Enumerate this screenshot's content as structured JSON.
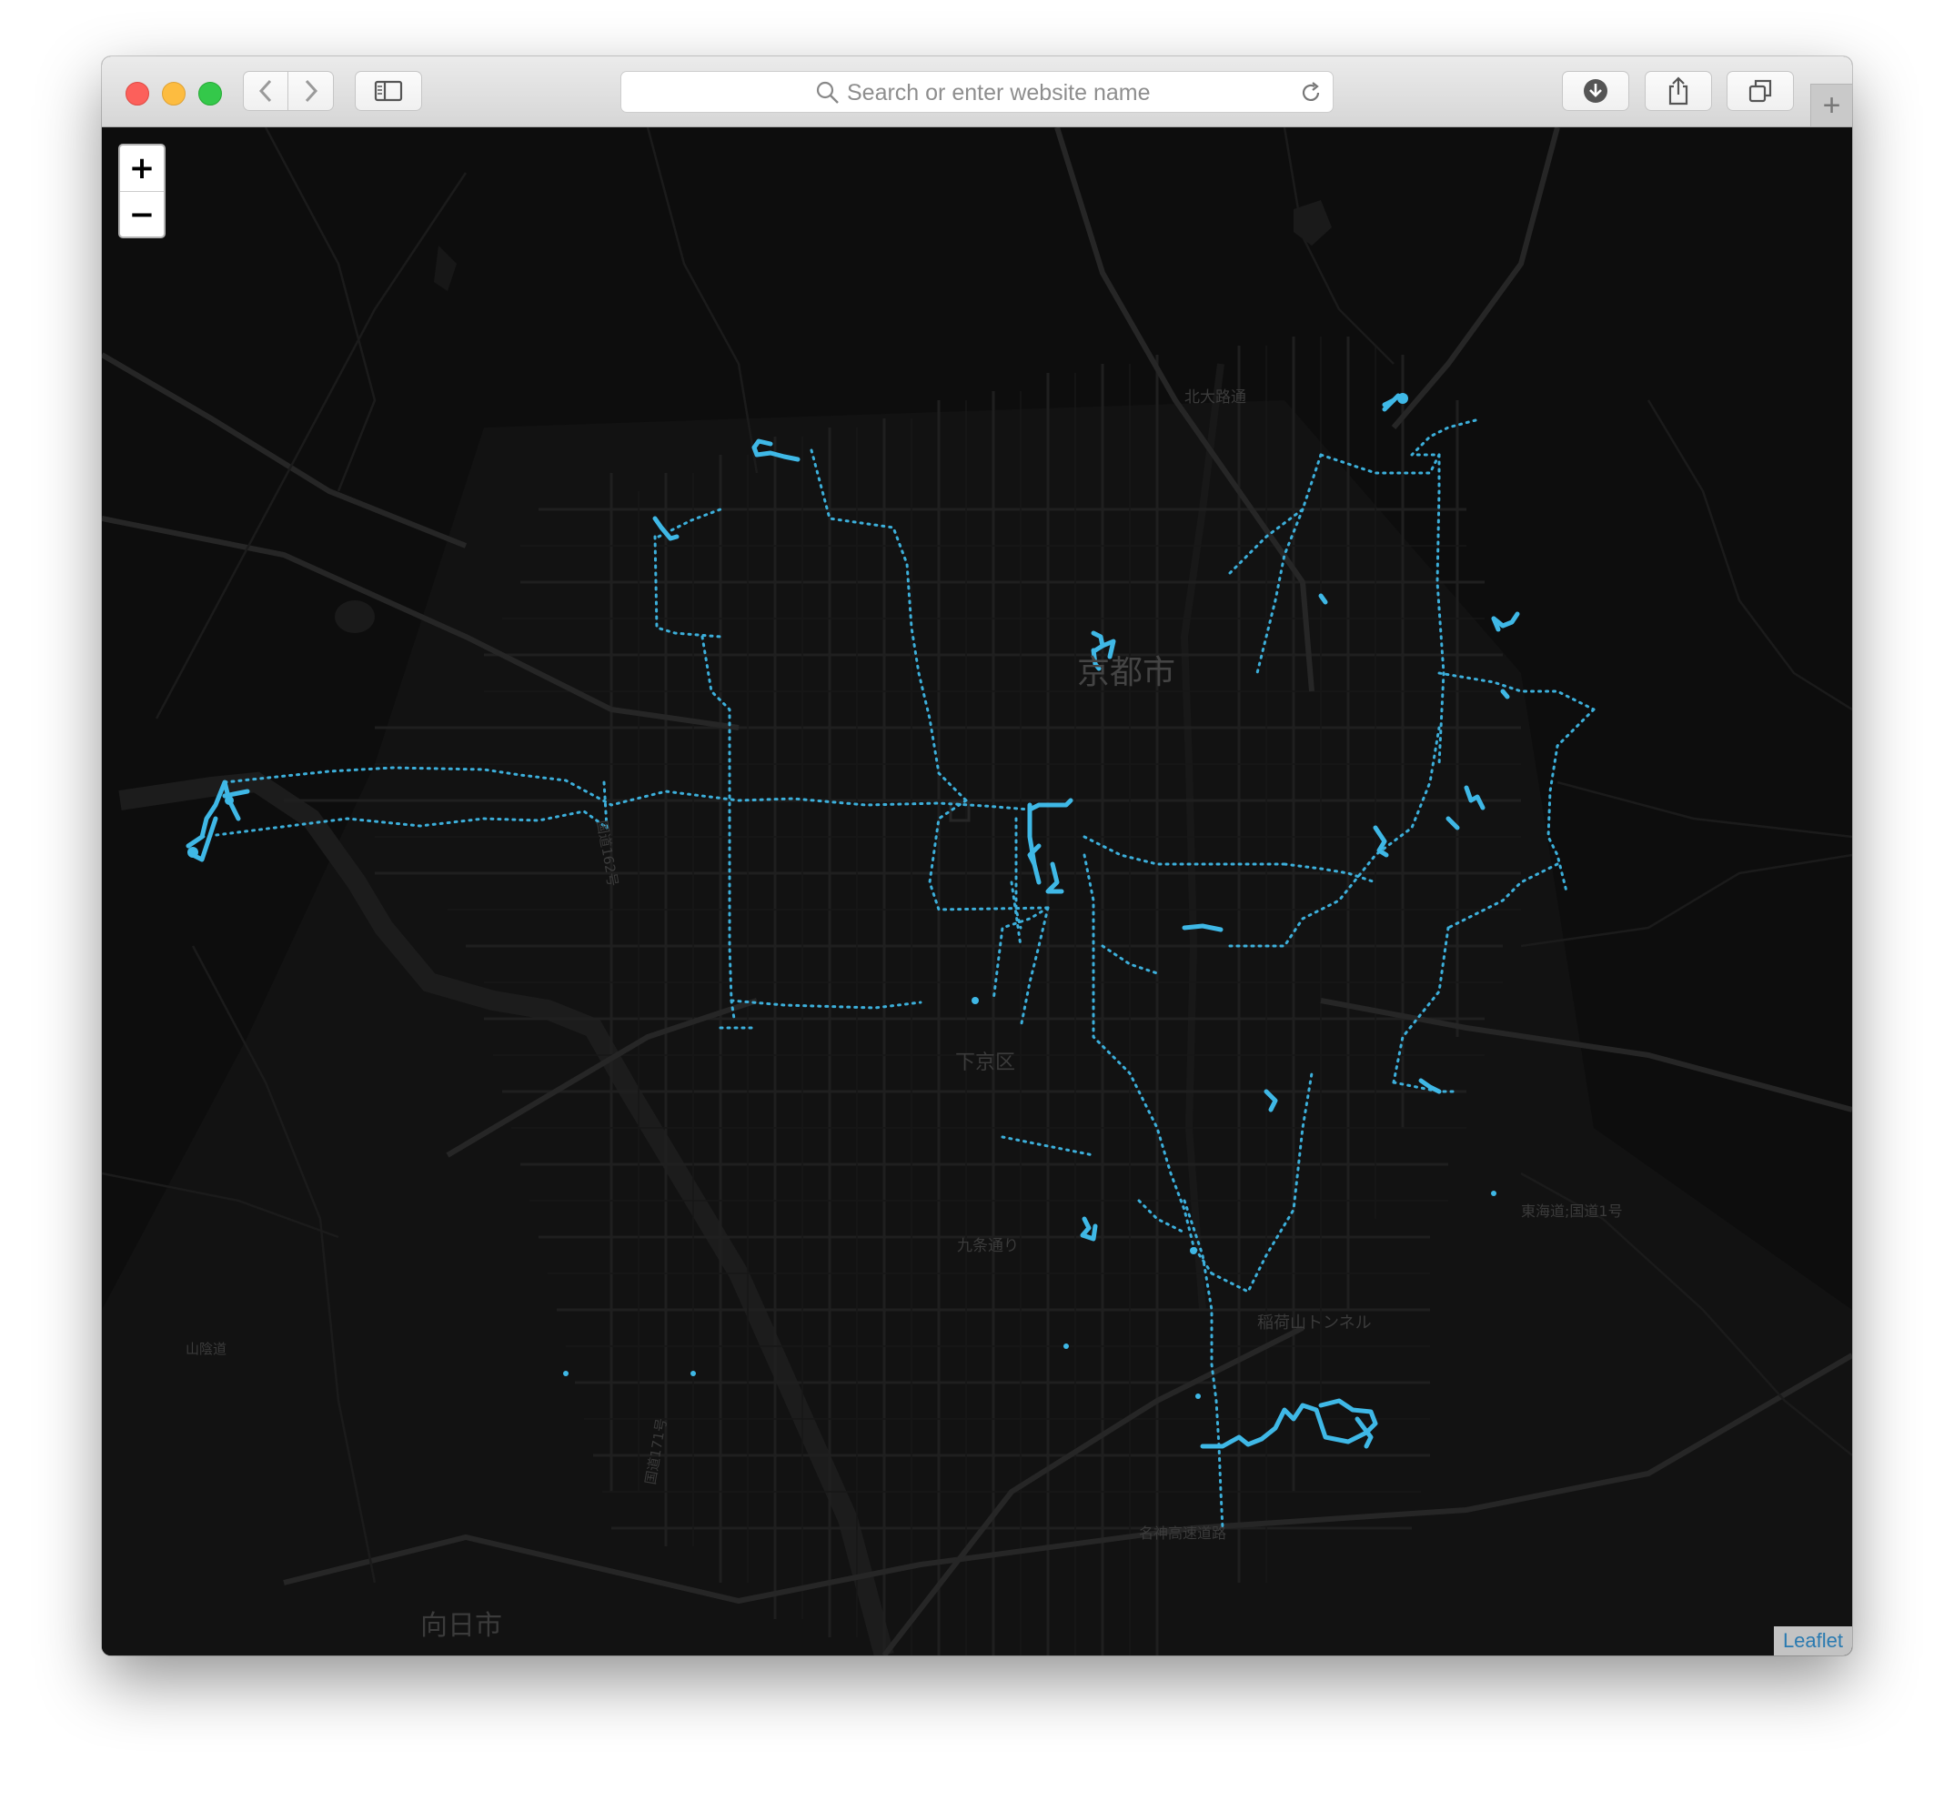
{
  "browser": {
    "url_placeholder": "Search or enter website name",
    "back_icon": "chevron-left-icon",
    "forward_icon": "chevron-right-icon",
    "sidebar_icon": "sidebar-icon",
    "reload_icon": "reload-icon",
    "download_icon": "download-icon",
    "share_icon": "share-icon",
    "tabs_icon": "tabs-icon",
    "new_tab_label": "+"
  },
  "map": {
    "zoom_in_label": "+",
    "zoom_out_label": "−",
    "attribution": "Leaflet",
    "track_color": "#3fb8e6",
    "labels": {
      "city": "京都市",
      "ward": "下京区",
      "muko": "向日市",
      "kitaoji": "北大路通",
      "kujo": "九条通り",
      "tunnel": "稲荷山トンネル",
      "tokaido": "東海道;国道1号",
      "meishin": "名神高速道路",
      "route162": "国道162号",
      "route171": "国道171号",
      "sanin": "山陰道"
    }
  }
}
